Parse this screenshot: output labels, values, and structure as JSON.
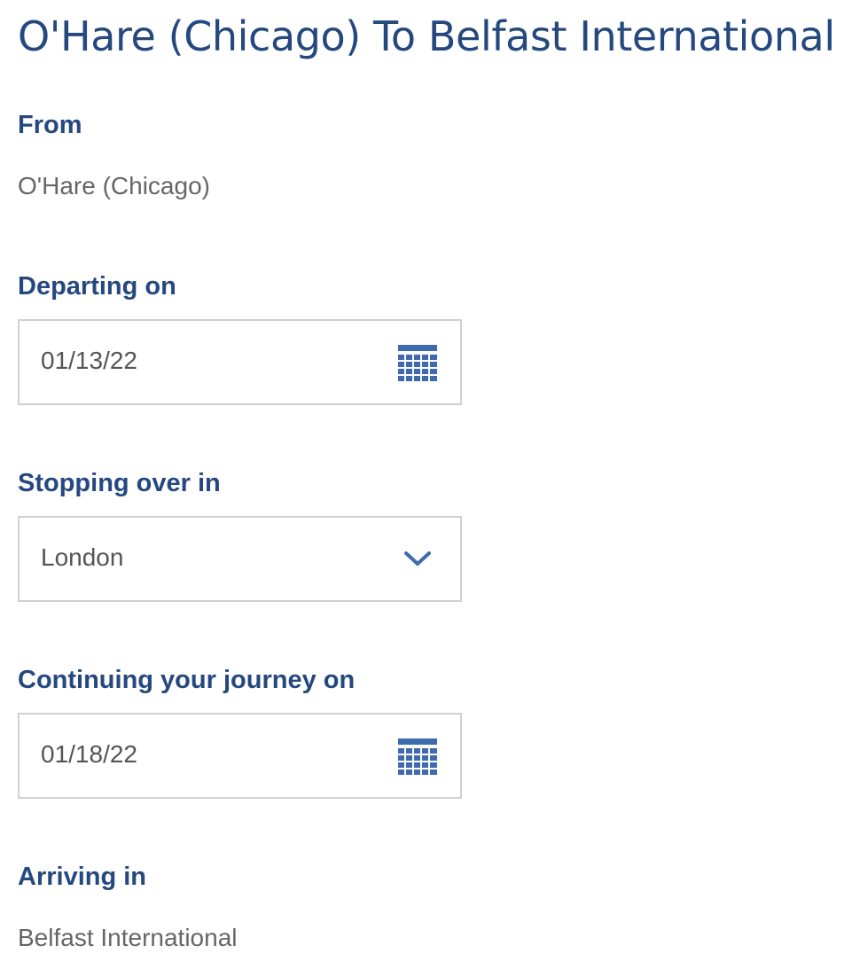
{
  "page": {
    "title": "O'Hare (Chicago) To Belfast International"
  },
  "from": {
    "label": "From",
    "value": "O'Hare (Chicago)"
  },
  "departing": {
    "label": "Departing on",
    "value": "01/13/22",
    "icon": "calendar-icon"
  },
  "stopover": {
    "label": "Stopping over in",
    "selected": "London",
    "icon": "chevron-down-icon"
  },
  "continuing": {
    "label": "Continuing your journey on",
    "value": "01/18/22",
    "icon": "calendar-icon"
  },
  "arriving": {
    "label": "Arriving in",
    "value": "Belfast International"
  },
  "colors": {
    "heading": "#24487f",
    "icon": "#3e6ab0",
    "border": "#d0d0d0",
    "text": "#666666"
  }
}
